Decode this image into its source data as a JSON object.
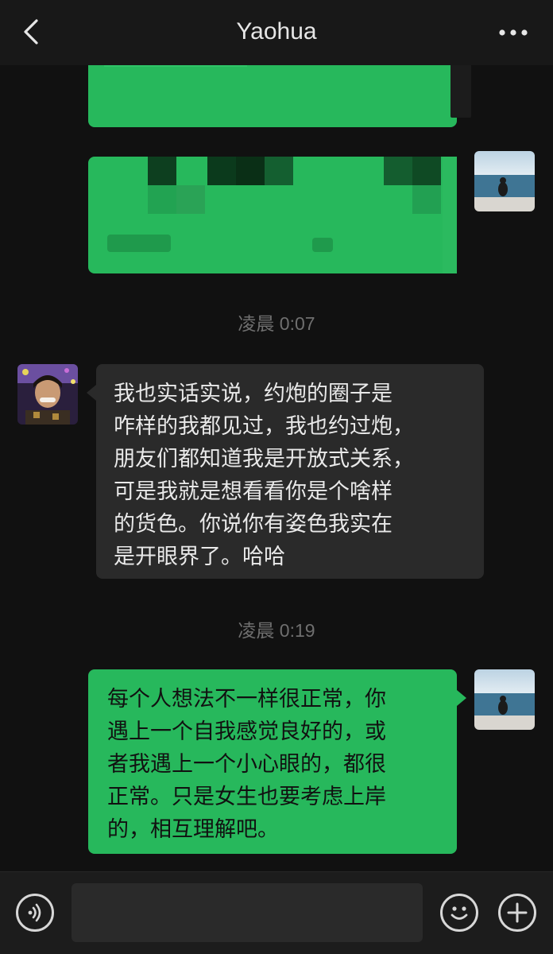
{
  "header": {
    "title": "Yaohua",
    "back_icon": "chevron-left-icon",
    "more_icon": "ellipsis-icon"
  },
  "colors": {
    "background": "#111111",
    "header": "#181818",
    "own_bubble": "#27b85c",
    "other_bubble": "#2a2a2a",
    "timestamp": "#6f6f6f"
  },
  "messages": [
    {
      "side": "right",
      "text": "",
      "redacted": true
    },
    {
      "side": "right",
      "text": "",
      "redacted": true
    },
    {
      "type": "timestamp",
      "text": "凌晨 0:07"
    },
    {
      "side": "left",
      "lines": [
        "我也实话实说，约炮的圈子是",
        "咋样的我都见过，我也约过炮，",
        "朋友们都知道我是开放式关系，",
        "可是我就是想看看你是个啥样",
        "的货色。你说你有姿色我实在",
        "是开眼界了。哈哈"
      ]
    },
    {
      "type": "timestamp",
      "text": "凌晨 0:19"
    },
    {
      "side": "right",
      "lines": [
        "每个人想法不一样很正常，你",
        "遇上一个自我感觉良好的，或",
        "者我遇上一个小心眼的，都很",
        "正常。只是女生也要考虑上岸",
        "的，相互理解吧。"
      ]
    }
  ],
  "input_bar": {
    "voice_icon": "voice-icon",
    "emoji_icon": "emoji-icon",
    "add_icon": "plus-icon",
    "input_value": ""
  }
}
